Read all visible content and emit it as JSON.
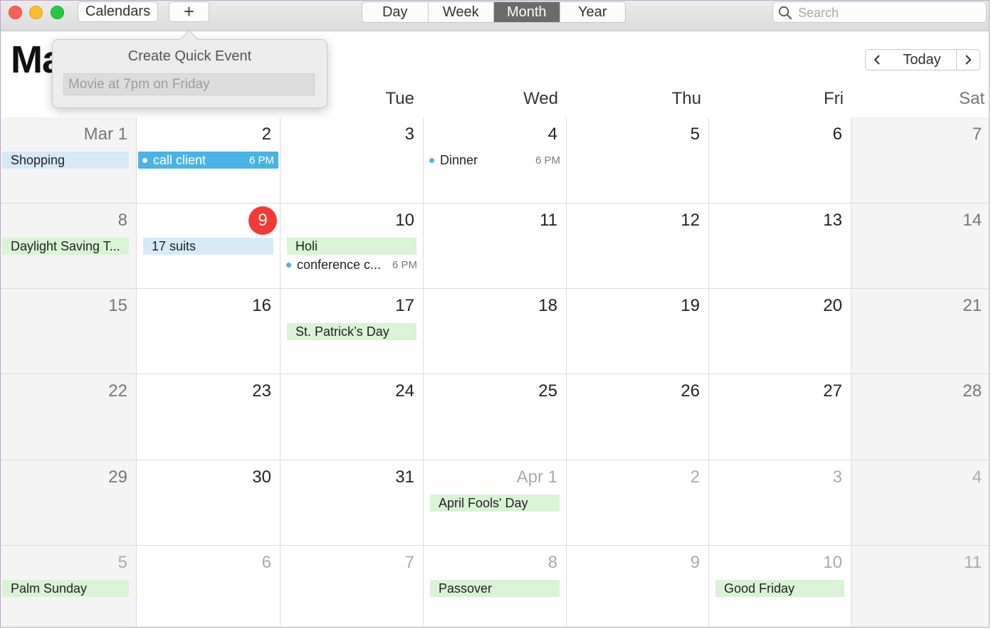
{
  "toolbar": {
    "calendars_label": "Calendars",
    "add_label": "+",
    "views": [
      "Day",
      "Week",
      "Month",
      "Year"
    ],
    "active_view": "Month",
    "search_placeholder": "Search"
  },
  "header": {
    "month_title": "Ma",
    "today_label": "Today"
  },
  "weekdays": [
    "",
    "",
    "Tue",
    "Wed",
    "Thu",
    "Fri",
    "Sat"
  ],
  "quick_event": {
    "title": "Create Quick Event",
    "placeholder": "Movie at 7pm on Friday"
  },
  "weeks": [
    [
      {
        "label": "Mar 1",
        "events": [
          {
            "kind": "allday",
            "color": "blue",
            "title": "Shopping"
          }
        ]
      },
      {
        "label": "2",
        "events": [
          {
            "kind": "solid",
            "title": "call client",
            "time": "6 PM"
          }
        ]
      },
      {
        "label": "3",
        "events": []
      },
      {
        "label": "4",
        "events": [
          {
            "kind": "timed",
            "title": "Dinner",
            "time": "6 PM"
          }
        ]
      },
      {
        "label": "5",
        "events": []
      },
      {
        "label": "6",
        "events": []
      },
      {
        "label": "7",
        "events": []
      }
    ],
    [
      {
        "label": "8",
        "events": [
          {
            "kind": "allday",
            "color": "green",
            "title": "Daylight Saving T..."
          }
        ]
      },
      {
        "label": "9",
        "today": true,
        "events": [
          {
            "kind": "allday",
            "color": "blue",
            "title": "17 suits"
          }
        ]
      },
      {
        "label": "10",
        "events": [
          {
            "kind": "allday",
            "color": "green",
            "title": "Holi"
          },
          {
            "kind": "timed",
            "title": "conference c...",
            "time": "6 PM"
          }
        ]
      },
      {
        "label": "11",
        "events": []
      },
      {
        "label": "12",
        "events": []
      },
      {
        "label": "13",
        "events": []
      },
      {
        "label": "14",
        "events": []
      }
    ],
    [
      {
        "label": "15",
        "events": []
      },
      {
        "label": "16",
        "events": []
      },
      {
        "label": "17",
        "events": [
          {
            "kind": "allday",
            "color": "green",
            "title": "St. Patrick’s Day"
          }
        ]
      },
      {
        "label": "18",
        "events": []
      },
      {
        "label": "19",
        "events": []
      },
      {
        "label": "20",
        "events": []
      },
      {
        "label": "21",
        "events": []
      }
    ],
    [
      {
        "label": "22",
        "events": []
      },
      {
        "label": "23",
        "events": []
      },
      {
        "label": "24",
        "events": []
      },
      {
        "label": "25",
        "events": []
      },
      {
        "label": "26",
        "events": []
      },
      {
        "label": "27",
        "events": []
      },
      {
        "label": "28",
        "events": []
      }
    ],
    [
      {
        "label": "29",
        "events": []
      },
      {
        "label": "30",
        "events": []
      },
      {
        "label": "31",
        "events": []
      },
      {
        "label": "Apr 1",
        "other": true,
        "events": [
          {
            "kind": "allday",
            "color": "green",
            "title": "April Fools' Day"
          }
        ]
      },
      {
        "label": "2",
        "other": true,
        "events": []
      },
      {
        "label": "3",
        "other": true,
        "events": []
      },
      {
        "label": "4",
        "other": true,
        "events": []
      }
    ],
    [
      {
        "label": "5",
        "other": true,
        "events": [
          {
            "kind": "allday",
            "color": "green",
            "title": "Palm Sunday"
          }
        ]
      },
      {
        "label": "6",
        "other": true,
        "events": []
      },
      {
        "label": "7",
        "other": true,
        "events": []
      },
      {
        "label": "8",
        "other": true,
        "events": [
          {
            "kind": "allday",
            "color": "green",
            "title": "Passover"
          }
        ]
      },
      {
        "label": "9",
        "other": true,
        "events": []
      },
      {
        "label": "10",
        "other": true,
        "events": [
          {
            "kind": "allday",
            "color": "green",
            "title": "Good Friday"
          }
        ]
      },
      {
        "label": "11",
        "other": true,
        "events": []
      }
    ]
  ]
}
